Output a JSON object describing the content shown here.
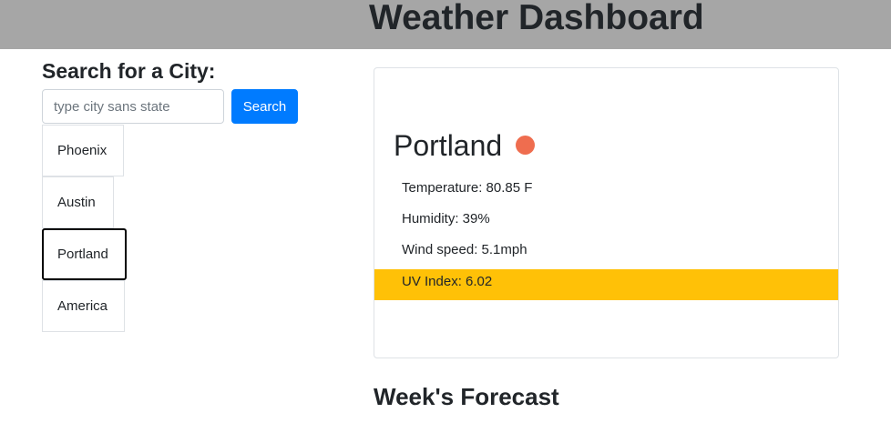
{
  "header": {
    "title": "Weather Dashboard"
  },
  "search": {
    "heading": "Search for a City:",
    "placeholder": "type city sans state",
    "value": "",
    "button_label": "Search"
  },
  "city_list": [
    {
      "label": "Phoenix",
      "active": false
    },
    {
      "label": "Austin",
      "active": false
    },
    {
      "label": "Portland",
      "active": true
    },
    {
      "label": "America",
      "active": false
    }
  ],
  "current": {
    "city": "Portland",
    "weather_icon": "weather-dot-icon",
    "temperature": "Temperature: 80.85 F",
    "humidity": "Humidity: 39%",
    "wind": "Wind speed: 5.1mph",
    "uv": "UV Index: 6.02"
  },
  "forecast": {
    "heading": "Week's Forecast"
  },
  "colors": {
    "header_bg": "#a6a6a6",
    "primary": "#007bff",
    "uv_warning": "#ffc107",
    "weather_icon": "#ef6d4f"
  }
}
